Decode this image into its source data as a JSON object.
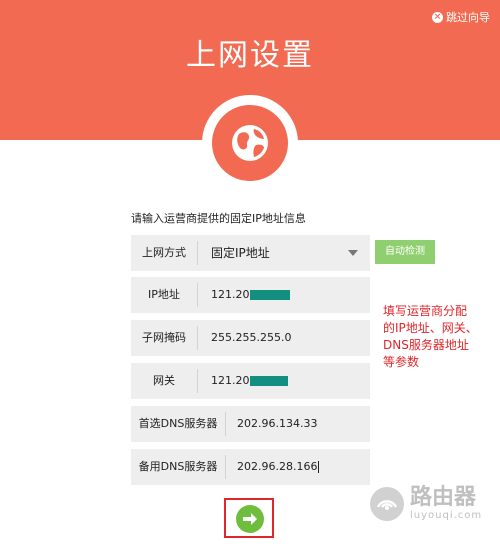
{
  "header": {
    "skip_label": "跳过向导",
    "title": "上网设置",
    "bg_color": "#f26a52"
  },
  "form": {
    "prompt": "请输入运营商提供的固定IP地址信息",
    "mode": {
      "label": "上网方式",
      "value": "固定IP地址"
    },
    "detect_label": "自动检测",
    "ip": {
      "label": "IP地址",
      "value": "121.201."
    },
    "subnet": {
      "label": "子网掩码",
      "value": "255.255.255.0"
    },
    "gateway": {
      "label": "网关",
      "value": "121.201."
    },
    "dns1": {
      "label": "首选DNS服务器",
      "value": "202.96.134.33"
    },
    "dns2": {
      "label": "备用DNS服务器",
      "value": "202.96.28.166"
    }
  },
  "annotation": {
    "text": "填写运营商分配\n的IP地址、网关、\nDNS服务器地址\n等参数",
    "color": "#e0262a"
  },
  "next_icon": "arrow-right-icon",
  "watermark": {
    "name": "路由器",
    "domain": "luyouqi.com"
  }
}
